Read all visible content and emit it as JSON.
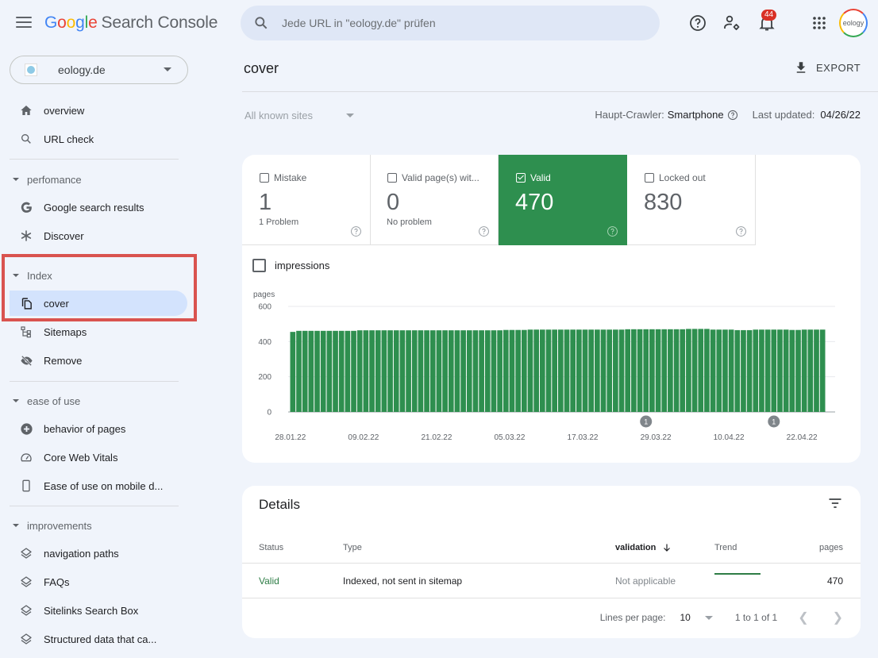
{
  "app": {
    "title_google": "Google",
    "title_rest": "Search Console"
  },
  "header": {
    "search_placeholder": "Jede URL in \"eology.de\" prüfen",
    "notification_count": "44",
    "avatar_label": "eology",
    "icons": [
      "help-icon",
      "manage-users-icon",
      "notifications-icon",
      "apps-grid-icon"
    ]
  },
  "property": {
    "name": "eology.de"
  },
  "sidebar": {
    "top_items": [
      {
        "label": "overview",
        "icon": "home-icon"
      },
      {
        "label": "URL check",
        "icon": "search-icon"
      }
    ],
    "sections": [
      {
        "label": "perfomance",
        "items": [
          {
            "label": "Google search results",
            "icon": "google-g-icon"
          },
          {
            "label": "Discover",
            "icon": "asterisk-icon"
          }
        ]
      },
      {
        "label": "Index",
        "items": [
          {
            "label": "cover",
            "icon": "copy-pages-icon",
            "active": true
          },
          {
            "label": "Sitemaps",
            "icon": "sitemap-icon"
          },
          {
            "label": "Remove",
            "icon": "visibility-off-icon"
          }
        ]
      },
      {
        "label": "ease of use",
        "items": [
          {
            "label": "behavior of pages",
            "icon": "plus-circle-icon"
          },
          {
            "label": "Core Web Vitals",
            "icon": "speed-gauge-icon"
          },
          {
            "label": "Ease of use on mobile d...",
            "icon": "smartphone-icon"
          }
        ]
      },
      {
        "label": "improvements",
        "items": [
          {
            "label": "navigation paths",
            "icon": "layers-icon"
          },
          {
            "label": "FAQs",
            "icon": "layers-icon"
          },
          {
            "label": "Sitelinks Search Box",
            "icon": "layers-icon"
          },
          {
            "label": "Structured data that ca...",
            "icon": "layers-icon"
          }
        ]
      }
    ]
  },
  "main": {
    "page_title": "cover",
    "export_label": "EXPORT",
    "site_filter": "All known sites",
    "crawler_label": "Haupt-Crawler:",
    "crawler_value": "Smartphone",
    "last_updated_label": "Last updated:",
    "last_updated_value": "04/26/22",
    "tiles": [
      {
        "label": "Mistake",
        "value": "1",
        "sub": "1 Problem",
        "checked": false
      },
      {
        "label": "Valid page(s) wit...",
        "value": "0",
        "sub": "No problem",
        "checked": false
      },
      {
        "label": "Valid",
        "value": "470",
        "sub": "",
        "checked": true
      },
      {
        "label": "Locked out",
        "value": "830",
        "sub": "",
        "checked": false
      }
    ],
    "impressions_label": "impressions",
    "colors": {
      "valid_green": "#2e8f4f",
      "status_green": "#2e7d46"
    }
  },
  "chart_data": {
    "type": "bar",
    "title": "",
    "ylabel": "pages",
    "xlabel": "",
    "ylim": [
      0,
      600
    ],
    "yticks": [
      0,
      200,
      400,
      600
    ],
    "x_tick_labels": [
      "28.01.22",
      "09.02.22",
      "21.02.22",
      "05.03.22",
      "17.03.22",
      "29.03.22",
      "10.04.22",
      "22.04.22"
    ],
    "grid": true,
    "series": [
      {
        "name": "Valid",
        "color": "#2e8f4f",
        "values": [
          455,
          461,
          461,
          461,
          461,
          461,
          461,
          461,
          461,
          461,
          461,
          464,
          464,
          464,
          464,
          464,
          464,
          464,
          464,
          464,
          464,
          464,
          464,
          464,
          464,
          464,
          464,
          464,
          464,
          464,
          464,
          464,
          464,
          464,
          464,
          466,
          466,
          466,
          466,
          468,
          468,
          468,
          468,
          468,
          468,
          468,
          468,
          468,
          468,
          468,
          468,
          468,
          468,
          468,
          468,
          470,
          470,
          470,
          470,
          470,
          470,
          470,
          470,
          470,
          470,
          472,
          472,
          472,
          472,
          468,
          468,
          468,
          468,
          465,
          465,
          465,
          468,
          468,
          468,
          468,
          468,
          468,
          466,
          466,
          468,
          468,
          468,
          468
        ]
      }
    ],
    "annotations": [
      {
        "date": "~27.03.22",
        "label": "1"
      },
      {
        "date": "~16.04.22",
        "label": "1"
      }
    ]
  },
  "details": {
    "title": "Details",
    "columns": [
      "Status",
      "Type",
      "validation",
      "Trend",
      "pages"
    ],
    "rows": [
      {
        "status": "Valid",
        "type": "Indexed, not sent in sitemap",
        "validation": "Not applicable",
        "pages": "470"
      }
    ],
    "pager": {
      "lines_label": "Lines per page:",
      "lines_value": "10",
      "range": "1 to 1 of 1"
    }
  }
}
